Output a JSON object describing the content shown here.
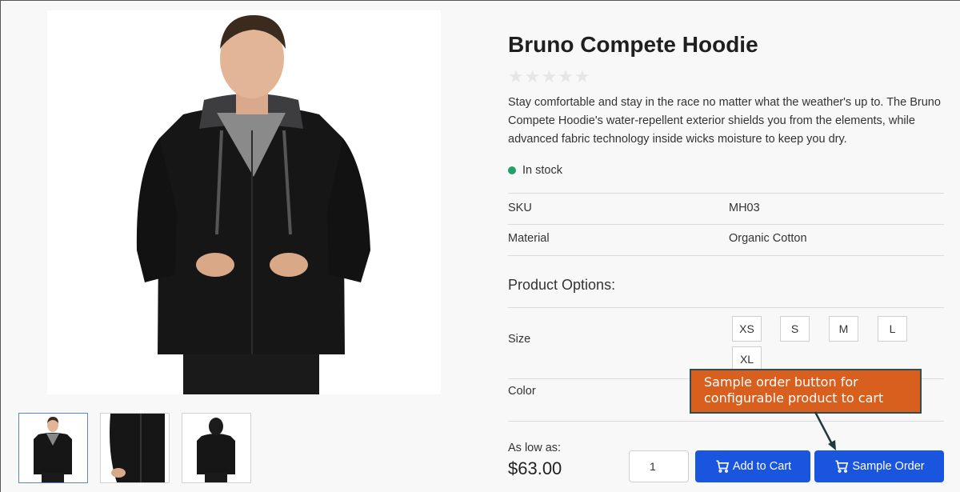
{
  "product": {
    "title": "Bruno Compete Hoodie",
    "rating_stars": "★★★★★",
    "description": "Stay comfortable and stay in the race no matter what the weather's up to. The Bruno Compete Hoodie's water-repellent exterior shields you from the elements, while advanced fabric technology inside wicks moisture to keep you dry.",
    "stock_status": "In stock",
    "attributes": [
      {
        "label": "SKU",
        "value": "MH03"
      },
      {
        "label": "Material",
        "value": "Organic Cotton"
      }
    ]
  },
  "options": {
    "title": "Product Options:",
    "size_label": "Size",
    "sizes": [
      "XS",
      "S",
      "M",
      "L",
      "XL"
    ],
    "color_label": "Color"
  },
  "purchase": {
    "price_label": "As low as:",
    "price": "$63.00",
    "quantity": "1",
    "add_to_cart_label": "Add to Cart",
    "sample_order_label": "Sample Order"
  },
  "callout": {
    "line1": "Sample order button for",
    "line2": "configurable product to cart"
  },
  "colors": {
    "primary_button": "#1a55e0",
    "callout_bg": "#d95f1e",
    "stock_dot": "#22a06b"
  }
}
